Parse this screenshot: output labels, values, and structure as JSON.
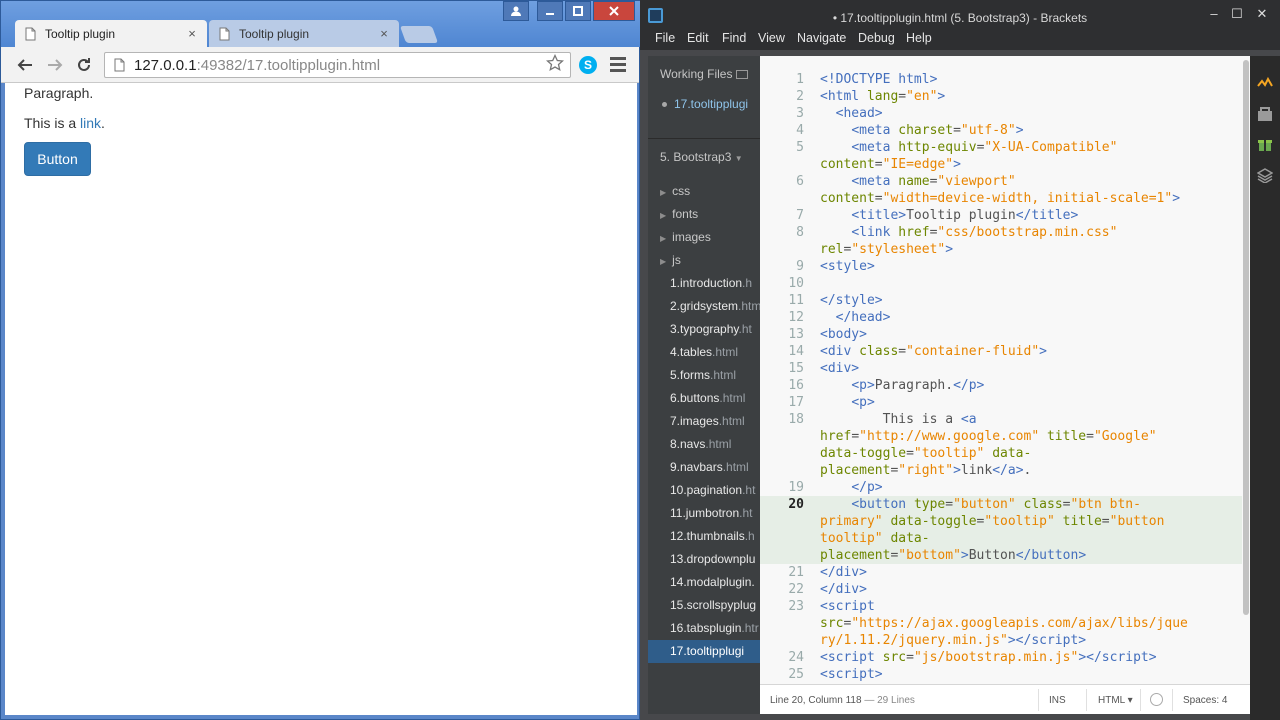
{
  "chrome": {
    "tabs": [
      {
        "title": "Tooltip plugin",
        "active": true
      },
      {
        "title": "Tooltip plugin",
        "active": false
      }
    ],
    "tab_close": "×",
    "url_host": "127.0.0.1",
    "url_rest": ":49382/17.tooltipplugin.html",
    "skype_letter": "S",
    "page": {
      "paragraph": "Paragraph.",
      "link_prefix": "This is a ",
      "link_text": "link",
      "link_suffix": ".",
      "button_label": "Button"
    },
    "colors": {
      "button": "#337ab7",
      "link": "#337ab7"
    }
  },
  "brackets": {
    "title": "• 17.tooltipplugin.html (5. Bootstrap3) - Brackets",
    "menu": [
      "File",
      "Edit",
      "Find",
      "View",
      "Navigate",
      "Debug",
      "Help"
    ],
    "working_files_label": "Working Files",
    "working_file": "17.tooltipplugi",
    "project_label": "5. Bootstrap3",
    "tree": [
      {
        "type": "folder",
        "name": "css"
      },
      {
        "type": "folder",
        "name": "fonts"
      },
      {
        "type": "folder",
        "name": "images"
      },
      {
        "type": "folder",
        "name": "js"
      },
      {
        "type": "file",
        "name": "1.introduction",
        "ext": ".h"
      },
      {
        "type": "file",
        "name": "2.gridsystem",
        "ext": ".htm"
      },
      {
        "type": "file",
        "name": "3.typography",
        "ext": ".ht"
      },
      {
        "type": "file",
        "name": "4.tables",
        "ext": ".html"
      },
      {
        "type": "file",
        "name": "5.forms",
        "ext": ".html"
      },
      {
        "type": "file",
        "name": "6.buttons",
        "ext": ".html"
      },
      {
        "type": "file",
        "name": "7.images",
        "ext": ".html"
      },
      {
        "type": "file",
        "name": "8.navs",
        "ext": ".html"
      },
      {
        "type": "file",
        "name": "9.navbars",
        "ext": ".html"
      },
      {
        "type": "file",
        "name": "10.pagination",
        "ext": ".ht"
      },
      {
        "type": "file",
        "name": "11.jumbotron",
        "ext": ".ht"
      },
      {
        "type": "file",
        "name": "12.thumbnails",
        "ext": ".h"
      },
      {
        "type": "file",
        "name": "13.dropdownplu",
        "ext": ""
      },
      {
        "type": "file",
        "name": "14.modalplugin.",
        "ext": ""
      },
      {
        "type": "file",
        "name": "15.scrollspyplug",
        "ext": ""
      },
      {
        "type": "file",
        "name": "16.tabsplugin",
        "ext": ".htr"
      },
      {
        "type": "file",
        "name": "17.tooltipplugi",
        "ext": "",
        "selected": true
      }
    ],
    "code_lines": [
      {
        "n": "1",
        "html": "<span class='t'>&lt;!DOCTYPE html&gt;</span>"
      },
      {
        "n": "2",
        "html": "<span class='t'>&lt;html</span> <span class='a'>lang</span>=<span class='s'>\"en\"</span><span class='t'>&gt;</span>"
      },
      {
        "n": "3",
        "html": "  <span class='t'>&lt;head&gt;</span>"
      },
      {
        "n": "4",
        "html": "    <span class='t'>&lt;meta</span> <span class='a'>charset</span>=<span class='s'>\"utf-8\"</span><span class='t'>&gt;</span>"
      },
      {
        "n": "5",
        "html": "    <span class='t'>&lt;meta</span> <span class='a'>http-equiv</span>=<span class='s'>\"X-UA-Compatible\"</span>"
      },
      {
        "n": "",
        "html": "<span class='a'>content</span>=<span class='s'>\"IE=edge\"</span><span class='t'>&gt;</span>"
      },
      {
        "n": "6",
        "html": "    <span class='t'>&lt;meta</span> <span class='a'>name</span>=<span class='s'>\"viewport\"</span>"
      },
      {
        "n": "",
        "html": "<span class='a'>content</span>=<span class='s'>\"width=device-width, initial-scale=1\"</span><span class='t'>&gt;</span>"
      },
      {
        "n": "7",
        "html": "    <span class='t'>&lt;title&gt;</span>Tooltip plugin<span class='t'>&lt;/title&gt;</span>"
      },
      {
        "n": "8",
        "html": "    <span class='t'>&lt;link</span> <span class='a'>href</span>=<span class='s'>\"css/bootstrap.min.css\"</span>"
      },
      {
        "n": "",
        "html": "<span class='a'>rel</span>=<span class='s'>\"stylesheet\"</span><span class='t'>&gt;</span>"
      },
      {
        "n": "9",
        "html": "<span class='t'>&lt;style&gt;</span>"
      },
      {
        "n": "10",
        "html": ""
      },
      {
        "n": "11",
        "html": "<span class='t'>&lt;/style&gt;</span>"
      },
      {
        "n": "12",
        "html": "  <span class='t'>&lt;/head&gt;</span>"
      },
      {
        "n": "13",
        "html": "<span class='t'>&lt;body&gt;</span>"
      },
      {
        "n": "14",
        "html": "<span class='t'>&lt;div</span> <span class='a'>class</span>=<span class='s'>\"container-fluid\"</span><span class='t'>&gt;</span>"
      },
      {
        "n": "15",
        "html": "<span class='t'>&lt;div&gt;</span>"
      },
      {
        "n": "16",
        "html": "    <span class='t'>&lt;p&gt;</span>Paragraph.<span class='t'>&lt;/p&gt;</span>"
      },
      {
        "n": "17",
        "html": "    <span class='t'>&lt;p&gt;</span>"
      },
      {
        "n": "18",
        "html": "        This is a <span class='t'>&lt;a</span>"
      },
      {
        "n": "",
        "html": "<span class='a'>href</span>=<span class='s'>\"http://www.google.com\"</span> <span class='a'>title</span>=<span class='s'>\"Google\"</span>"
      },
      {
        "n": "",
        "html": "<span class='a'>data-toggle</span>=<span class='s'>\"tooltip\"</span> <span class='a'>data-</span>"
      },
      {
        "n": "",
        "html": "<span class='a'>placement</span>=<span class='s'>\"right\"</span><span class='t'>&gt;</span>link<span class='t'>&lt;/a&gt;</span>."
      },
      {
        "n": "19",
        "html": "    <span class='t'>&lt;/p&gt;</span>"
      },
      {
        "n": "20",
        "cur": true,
        "html": "    <span class='t'>&lt;button</span> <span class='a'>type</span>=<span class='s'>\"button\"</span> <span class='a'>class</span>=<span class='s'>\"btn btn-</span>"
      },
      {
        "n": "",
        "cur": true,
        "html": "<span class='s'>primary\"</span> <span class='a'>data-toggle</span>=<span class='s'>\"tooltip\"</span> <span class='a'>title</span>=<span class='s'>\"button</span>"
      },
      {
        "n": "",
        "cur": true,
        "html": "<span class='s'>tooltip\"</span> <span class='a'>data-</span>"
      },
      {
        "n": "",
        "cur": true,
        "html": "<span class='a'>placement</span>=<span class='s'>\"bottom\"</span><span class='t'>&gt;</span>Button<span class='t'>&lt;/button&gt;</span>"
      },
      {
        "n": "21",
        "html": "<span class='t'>&lt;/div&gt;</span>"
      },
      {
        "n": "22",
        "html": "<span class='t'>&lt;/div&gt;</span>"
      },
      {
        "n": "23",
        "html": "<span class='t'>&lt;script</span>"
      },
      {
        "n": "",
        "html": "<span class='a'>src</span>=<span class='s'>\"https://ajax.googleapis.com/ajax/libs/jque</span>"
      },
      {
        "n": "",
        "html": "<span class='s'>ry/1.11.2/jquery.min.js\"</span><span class='t'>&gt;&lt;/script&gt;</span>"
      },
      {
        "n": "24",
        "html": "<span class='t'>&lt;script</span> <span class='a'>src</span>=<span class='s'>\"js/bootstrap.min.js\"</span><span class='t'>&gt;&lt;/script&gt;</span>"
      },
      {
        "n": "25",
        "html": "<span class='t'>&lt;script&gt;</span>"
      }
    ],
    "status": {
      "cursor": "Line 20, Column 118",
      "lines": " — 29 Lines",
      "ins": "INS",
      "mode": "HTML ▾",
      "spaces": "Spaces: 4"
    }
  }
}
